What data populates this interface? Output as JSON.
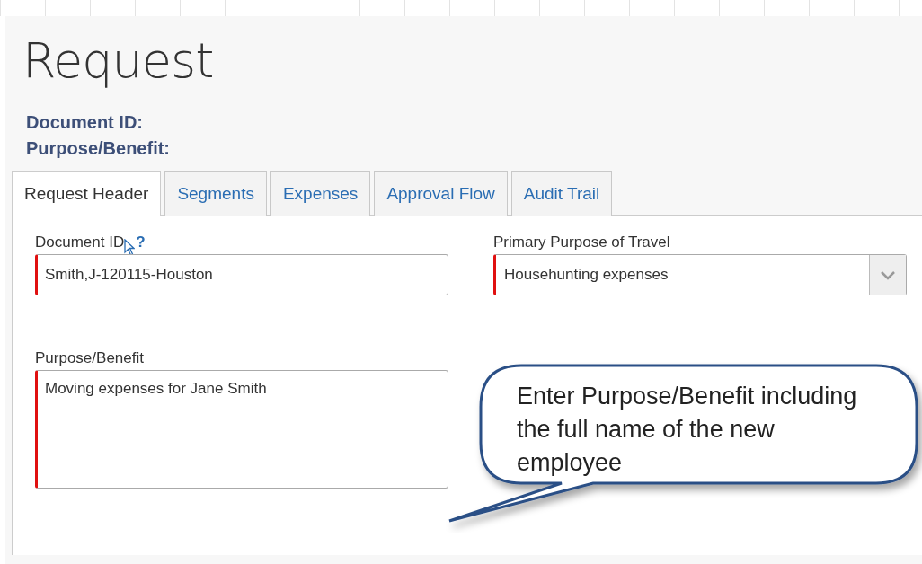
{
  "page": {
    "title": "Request"
  },
  "summary": [
    {
      "label": "Document ID:"
    },
    {
      "label": "Purpose/Benefit:"
    }
  ],
  "tabs": [
    {
      "label": "Request Header",
      "selected": true
    },
    {
      "label": "Segments",
      "selected": false
    },
    {
      "label": "Expenses",
      "selected": false
    },
    {
      "label": "Approval Flow",
      "selected": false
    },
    {
      "label": "Audit Trail",
      "selected": false
    }
  ],
  "fields": [
    {
      "kind": "text",
      "label": "Document ID",
      "help_mark": "?",
      "value": "Smith,J-120115-Houston",
      "required": true
    },
    {
      "kind": "select",
      "label": "Primary Purpose of Travel",
      "value": "Househunting expenses",
      "required": true
    },
    {
      "kind": "textarea",
      "label": "Purpose/Benefit",
      "value": "Moving expenses for Jane Smith",
      "required": true
    }
  ],
  "callout": {
    "text": "Enter Purpose/Benefit including the full name of the new employee"
  }
}
